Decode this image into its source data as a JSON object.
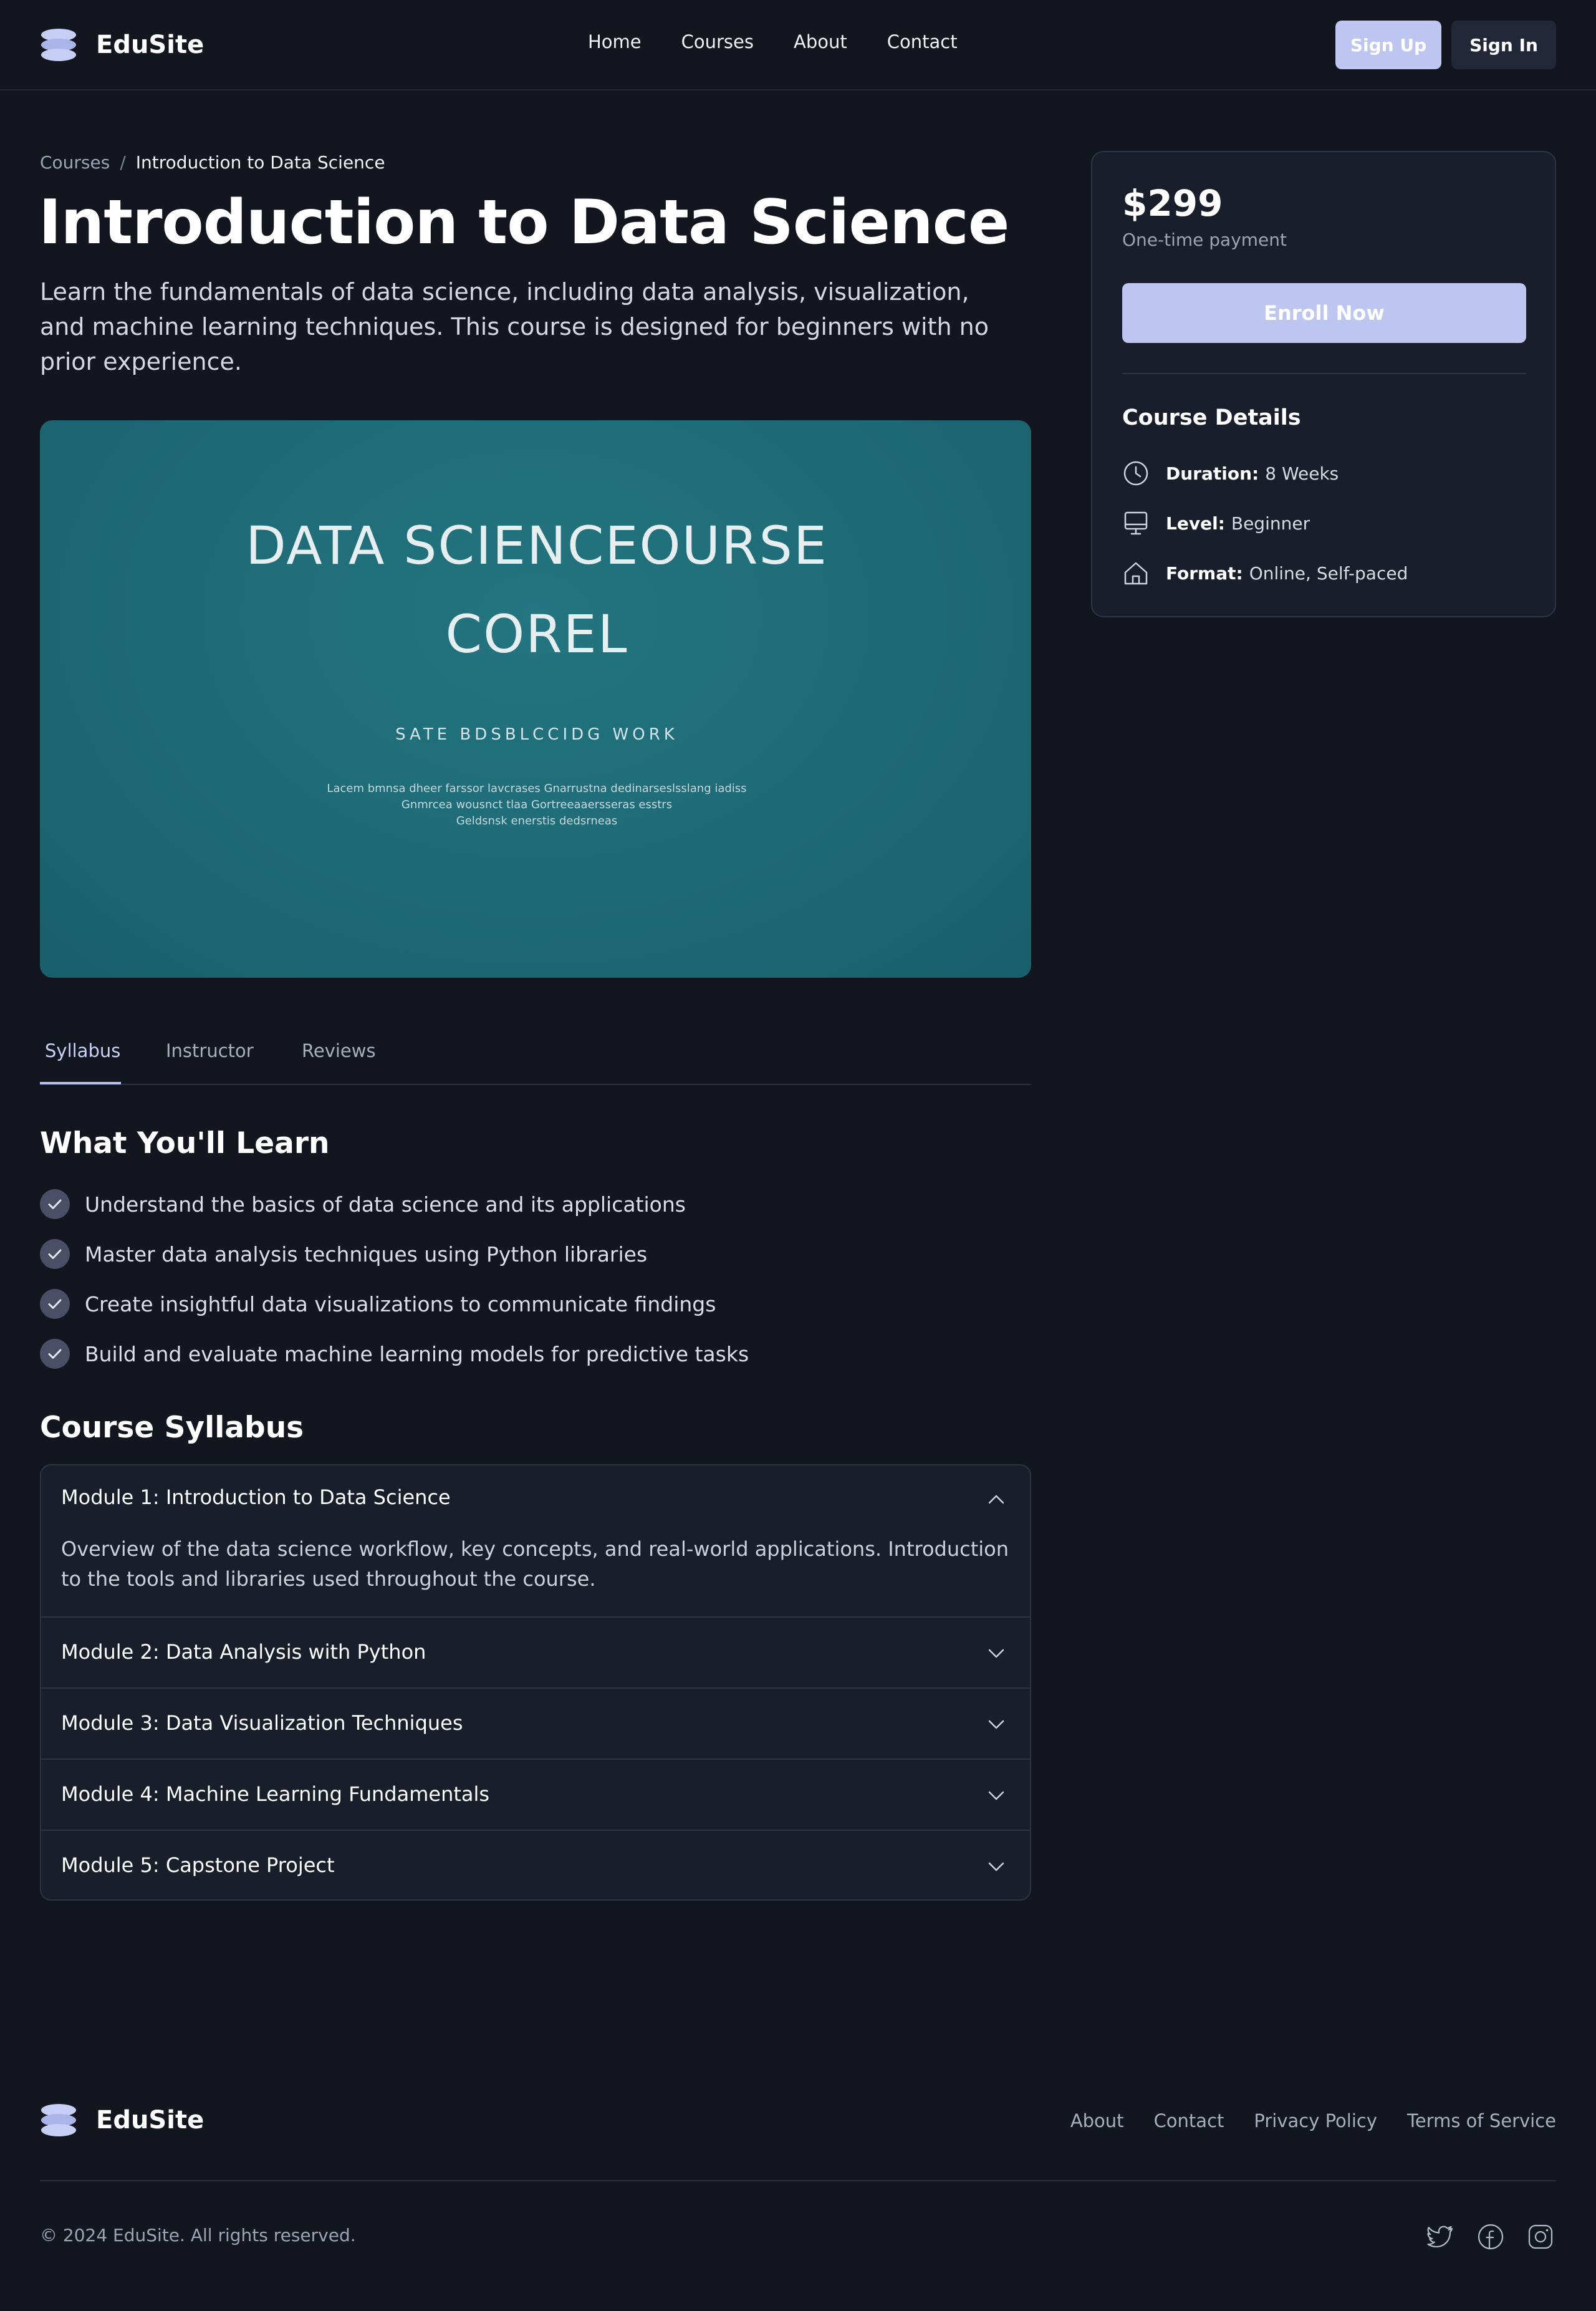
{
  "header": {
    "brand": "EduSite",
    "nav": [
      "Home",
      "Courses",
      "About",
      "Contact"
    ],
    "sign_up": "Sign Up",
    "sign_in": "Sign In"
  },
  "breadcrumb": {
    "parent": "Courses",
    "separator": "/",
    "current": "Introduction to Data Science"
  },
  "course": {
    "title": "Introduction to Data Science",
    "description": "Learn the fundamentals of data science, including data analysis, visualization, and machine learning techniques. This course is designed for beginners with no prior experience."
  },
  "hero_image": {
    "line1": "DATA SCIENCEOURSE",
    "line2": "COREL",
    "subtitle": "SATE BDSBLCCIDG WORK",
    "small_text": [
      "Lacem bmnsa dheer farssor lavcrases Gnarrustna dedinarseslsslang iadiss",
      "Gnmrcea wousnct tlaa Gortreeaaersseras esstrs",
      "Geldsnsk enerstis dedsrneas"
    ]
  },
  "tabs": {
    "items": [
      "Syllabus",
      "Instructor",
      "Reviews"
    ],
    "active": "Syllabus"
  },
  "learn": {
    "heading": "What You'll Learn",
    "items": [
      "Understand the basics of data science and its applications",
      "Master data analysis techniques using Python libraries",
      "Create insightful data visualizations to communicate findings",
      "Build and evaluate machine learning models for predictive tasks"
    ]
  },
  "syllabus": {
    "heading": "Course Syllabus",
    "modules": [
      {
        "title": "Module 1: Introduction to Data Science",
        "expanded": true,
        "body": "Overview of the data science workflow, key concepts, and real-world applications. Introduction to the tools and libraries used throughout the course."
      },
      {
        "title": "Module 2: Data Analysis with Python",
        "expanded": false
      },
      {
        "title": "Module 3: Data Visualization Techniques",
        "expanded": false
      },
      {
        "title": "Module 4: Machine Learning Fundamentals",
        "expanded": false
      },
      {
        "title": "Module 5: Capstone Project",
        "expanded": false
      }
    ]
  },
  "pricing": {
    "price": "$299",
    "note": "One-time payment",
    "enroll": "Enroll Now",
    "details_heading": "Course Details",
    "details": [
      {
        "icon": "clock-icon",
        "label": "Duration:",
        "value": "8 Weeks"
      },
      {
        "icon": "monitor-icon",
        "label": "Level:",
        "value": "Beginner"
      },
      {
        "icon": "home-icon",
        "label": "Format:",
        "value": "Online, Self-paced"
      }
    ]
  },
  "footer": {
    "brand": "EduSite",
    "links": [
      "About",
      "Contact",
      "Privacy Policy",
      "Terms of Service"
    ],
    "copyright": "© 2024 EduSite. All rights reserved.",
    "social": [
      "twitter-icon",
      "facebook-icon",
      "instagram-icon"
    ]
  },
  "colors": {
    "background": "#13151f",
    "surface": "#1a1e2a",
    "accent": "#bcc6f0",
    "border": "#2f3442",
    "hero_teal": "#1e6c78"
  }
}
